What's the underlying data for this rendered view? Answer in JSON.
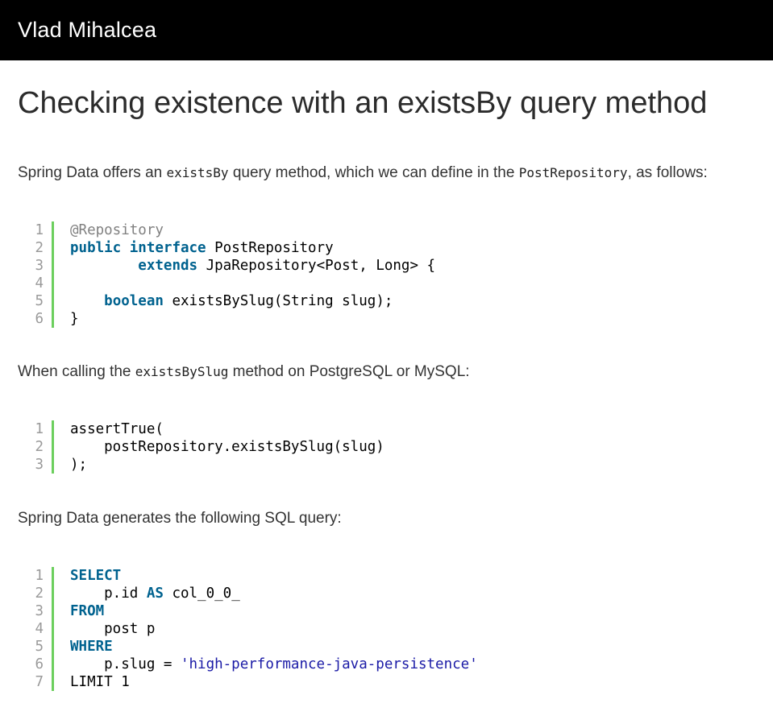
{
  "header": {
    "brand": "Vlad Mihalcea"
  },
  "article": {
    "title": "Checking existence with an existsBy query method",
    "para1": {
      "t1": "Spring Data offers an ",
      "c1": "existsBy",
      "t2": " query method, which we can define in the ",
      "c2": "PostRepository",
      "t3": ", as follows:"
    },
    "code1": {
      "line_numbers": [
        "1",
        "2",
        "3",
        "4",
        "5",
        "6"
      ],
      "lines": [
        [
          {
            "t": "@Repository",
            "c": "ann"
          }
        ],
        [
          {
            "t": "public",
            "c": "kw"
          },
          {
            "t": " "
          },
          {
            "t": "interface",
            "c": "kw"
          },
          {
            "t": " PostRepository"
          }
        ],
        [
          {
            "t": "        "
          },
          {
            "t": "extends",
            "c": "kw"
          },
          {
            "t": " JpaRepository<Post, Long> {"
          }
        ],
        [
          {
            "t": ""
          }
        ],
        [
          {
            "t": "    "
          },
          {
            "t": "boolean",
            "c": "kw"
          },
          {
            "t": " existsBySlug(String slug);"
          }
        ],
        [
          {
            "t": "}"
          }
        ]
      ]
    },
    "para2": {
      "t1": "When calling the ",
      "c1": "existsBySlug",
      "t2": " method on PostgreSQL or MySQL:"
    },
    "code2": {
      "line_numbers": [
        "1",
        "2",
        "3"
      ],
      "lines": [
        [
          {
            "t": "assertTrue("
          }
        ],
        [
          {
            "t": "    postRepository.existsBySlug(slug)"
          }
        ],
        [
          {
            "t": ");"
          }
        ]
      ]
    },
    "para3": {
      "t1": "Spring Data generates the following SQL query:"
    },
    "code3": {
      "line_numbers": [
        "1",
        "2",
        "3",
        "4",
        "5",
        "6",
        "7"
      ],
      "lines": [
        [
          {
            "t": "SELECT",
            "c": "kw"
          }
        ],
        [
          {
            "t": "    p.id "
          },
          {
            "t": "AS",
            "c": "kw"
          },
          {
            "t": " col_0_0_"
          }
        ],
        [
          {
            "t": "FROM",
            "c": "kw"
          }
        ],
        [
          {
            "t": "    post p"
          }
        ],
        [
          {
            "t": "WHERE",
            "c": "kw"
          }
        ],
        [
          {
            "t": "    p.slug = "
          },
          {
            "t": "'high-performance-java-persistence'",
            "c": "str"
          }
        ],
        [
          {
            "t": "LIMIT 1"
          }
        ]
      ]
    }
  }
}
